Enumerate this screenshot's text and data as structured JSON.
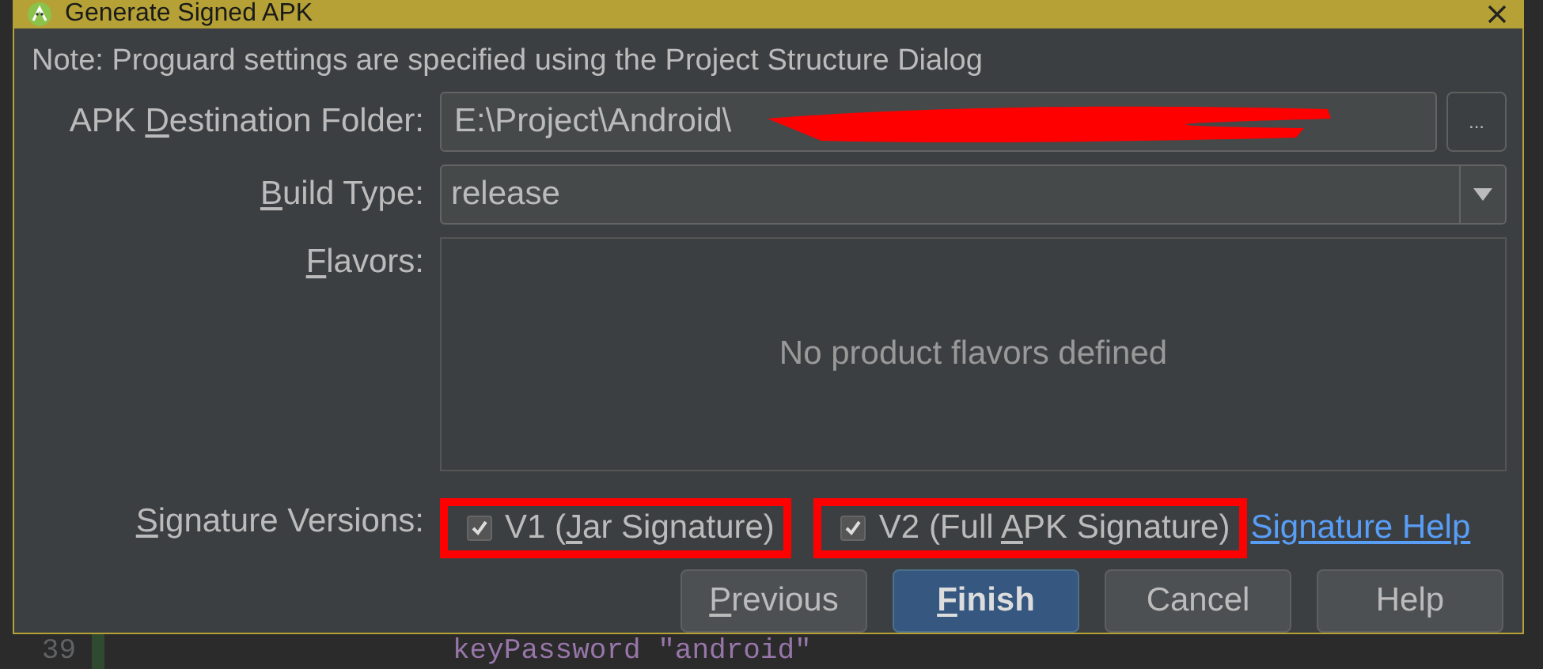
{
  "window": {
    "title": "Generate Signed APK"
  },
  "note": "Note: Proguard settings are specified using the Project Structure Dialog",
  "destination": {
    "label": {
      "before": "APK ",
      "underlined": "D",
      "after": "estination Folder:"
    },
    "value": "E:\\Project\\Android\\",
    "redacted": true,
    "browse": "..."
  },
  "build_type": {
    "label": {
      "underlined": "B",
      "after": "uild Type:"
    },
    "value": "release"
  },
  "flavors": {
    "label": {
      "underlined": "F",
      "after": "lavors:"
    },
    "empty_text": "No product flavors defined"
  },
  "signature": {
    "label": {
      "underlined": "S",
      "after": "ignature Versions:"
    },
    "options": [
      {
        "label": {
          "before": "V1 (",
          "underlined": "J",
          "after": "ar Signature)"
        },
        "checked": true,
        "annotated": true
      },
      {
        "label": {
          "before": "V2 (Full ",
          "underlined": "A",
          "after": "PK Signature)"
        },
        "checked": true,
        "annotated": true
      }
    ],
    "help_link": "Signature Help"
  },
  "buttons": [
    {
      "label": {
        "underlined": "P",
        "after": "revious"
      },
      "default": false
    },
    {
      "label": {
        "underlined": "F",
        "after": "inish"
      },
      "default": true
    },
    {
      "label": {
        "after": "Cancel"
      },
      "default": false
    },
    {
      "label": {
        "after": "Help"
      },
      "default": false
    }
  ],
  "editor": {
    "line_number": "39",
    "code": "keyPassword \"android\""
  }
}
